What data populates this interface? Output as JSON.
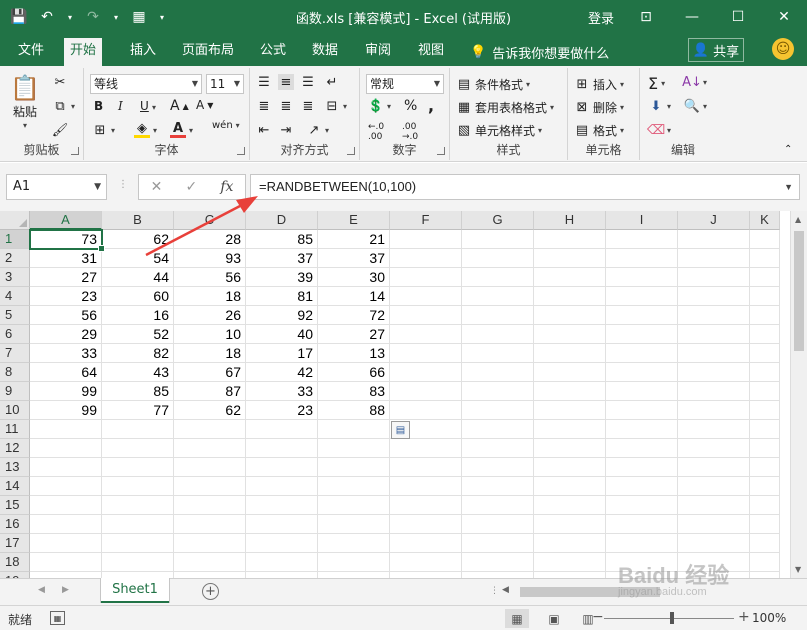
{
  "window": {
    "title": "函数.xls  [兼容模式] - Excel (试用版)",
    "login": "登录"
  },
  "tabs": [
    "文件",
    "开始",
    "插入",
    "页面布局",
    "公式",
    "数据",
    "审阅",
    "视图"
  ],
  "active_tab": "开始",
  "tell_me": "告诉我你想要做什么",
  "share": "共享",
  "ribbon": {
    "clipboard": {
      "paste": "粘贴",
      "label": "剪贴板"
    },
    "font": {
      "name": "等线",
      "size": "11",
      "label": "字体",
      "bold": "B",
      "italic": "I",
      "underline": "U",
      "wen": "wén"
    },
    "alignment": {
      "label": "对齐方式"
    },
    "number": {
      "format": "常规",
      "percent": "%",
      "comma": ",",
      "label": "数字"
    },
    "styles": {
      "conditional": "条件格式",
      "table": "套用表格格式",
      "cell": "单元格样式",
      "label": "样式"
    },
    "cells": {
      "insert": "插入",
      "delete": "删除",
      "format": "格式",
      "label": "单元格"
    },
    "editing": {
      "label": "编辑"
    }
  },
  "formula_bar": {
    "name_box": "A1",
    "fx": "fx",
    "formula": "=RANDBETWEEN(10,100)"
  },
  "grid": {
    "columns": [
      "A",
      "B",
      "C",
      "D",
      "E",
      "F",
      "G",
      "H",
      "I",
      "J",
      "K"
    ],
    "rows": [
      "1",
      "2",
      "3",
      "4",
      "5",
      "6",
      "7",
      "8",
      "9",
      "10",
      "11",
      "12",
      "13",
      "14",
      "15",
      "16",
      "17",
      "18",
      "19"
    ],
    "data": [
      [
        "73",
        "62",
        "28",
        "85",
        "21"
      ],
      [
        "31",
        "54",
        "93",
        "37",
        "37"
      ],
      [
        "27",
        "44",
        "56",
        "39",
        "30"
      ],
      [
        "23",
        "60",
        "18",
        "81",
        "14"
      ],
      [
        "56",
        "16",
        "26",
        "92",
        "72"
      ],
      [
        "29",
        "52",
        "10",
        "40",
        "27"
      ],
      [
        "33",
        "82",
        "18",
        "17",
        "13"
      ],
      [
        "64",
        "43",
        "67",
        "42",
        "66"
      ],
      [
        "99",
        "85",
        "87",
        "33",
        "83"
      ],
      [
        "99",
        "77",
        "62",
        "23",
        "88"
      ]
    ],
    "active_cell": "A1"
  },
  "sheet": {
    "tab": "Sheet1",
    "add": "+"
  },
  "status": {
    "ready": "就绪",
    "zoom": "100%"
  },
  "watermark": {
    "brand": "Baidu 经验",
    "url": "jingyan.baidu.com"
  },
  "colors": {
    "accent": "#217346",
    "arrow": "#e8403a"
  }
}
